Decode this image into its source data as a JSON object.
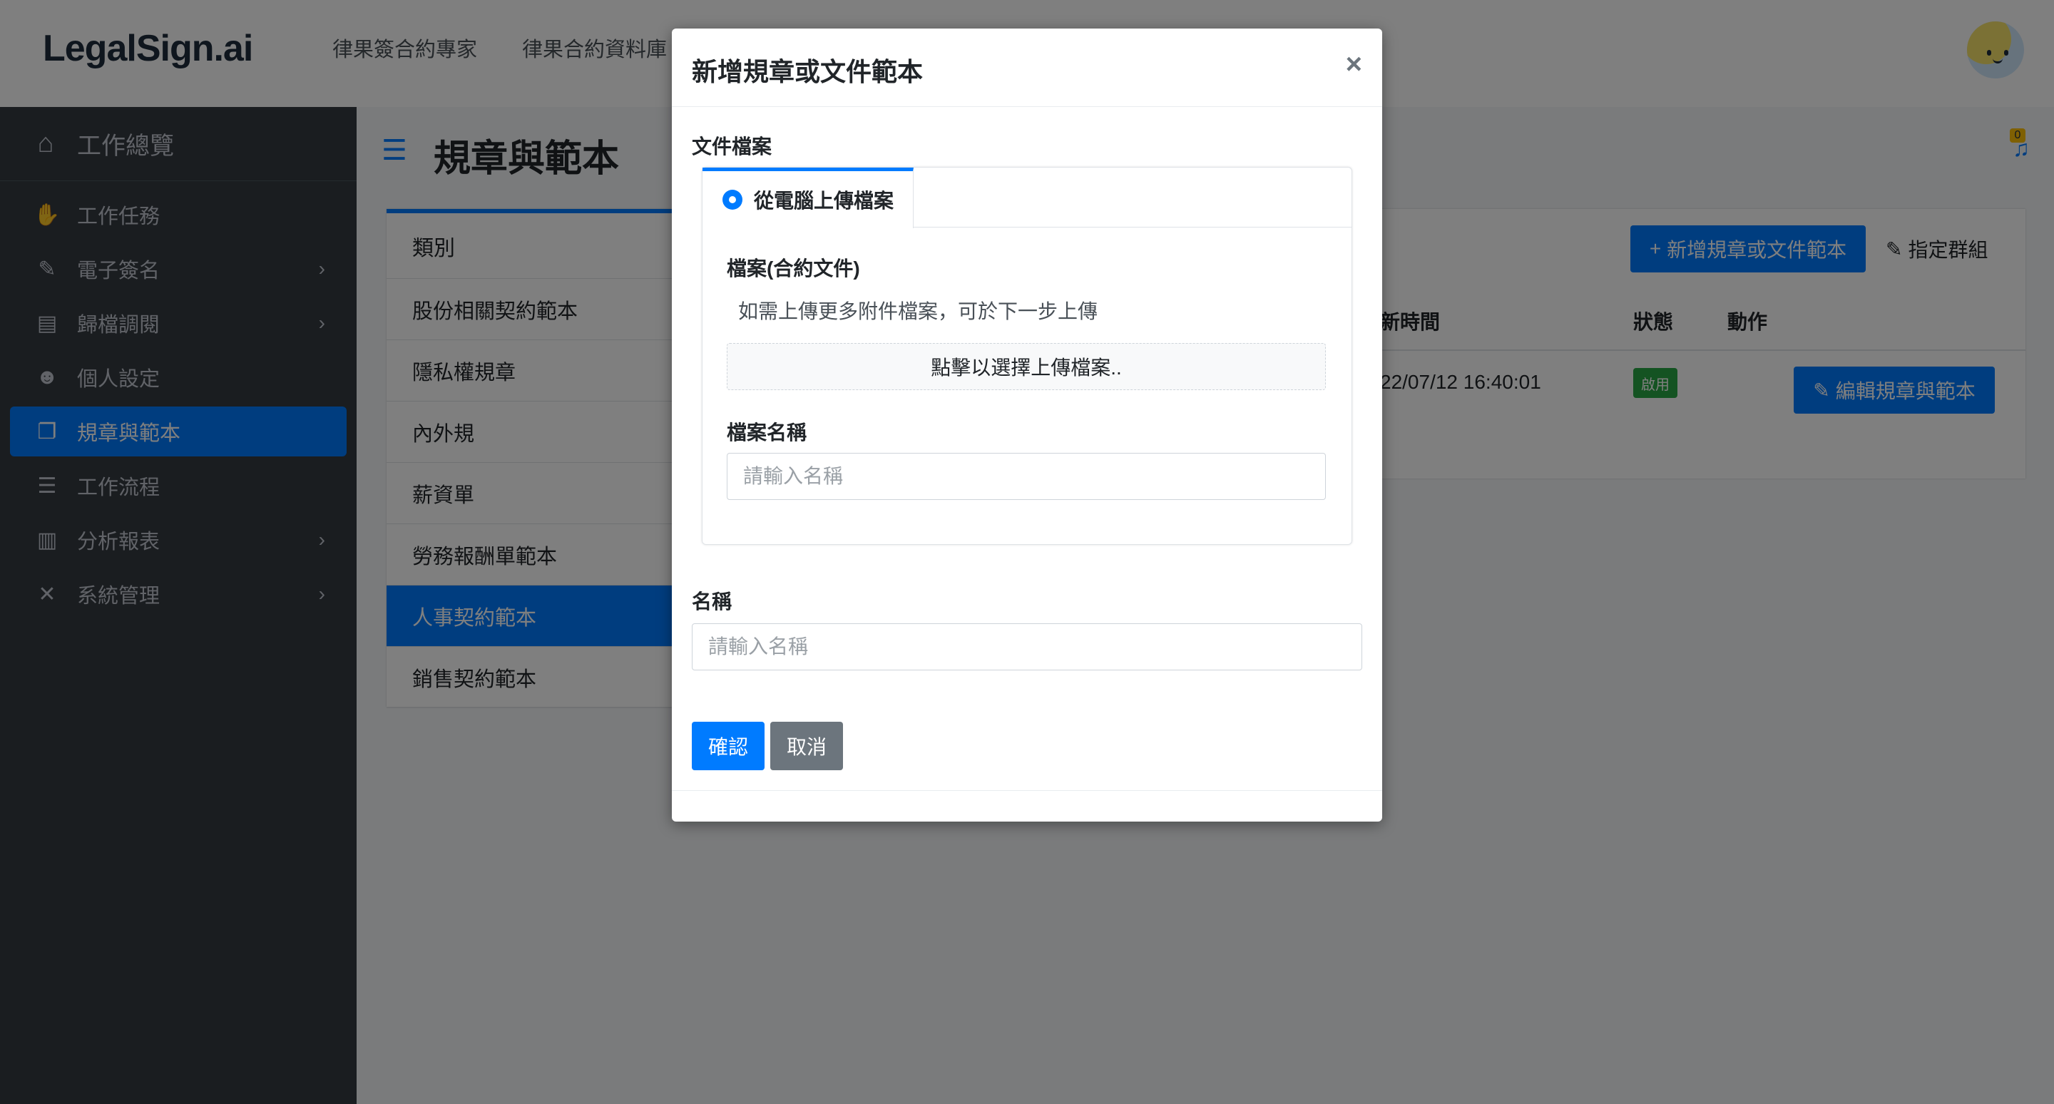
{
  "topbar": {
    "logo": "LegalSign.ai",
    "nav": [
      "律果簽合約專家",
      "律果合約資料庫"
    ]
  },
  "sidebar": {
    "brand": {
      "label": "工作總覽",
      "icon": "home-icon"
    },
    "items": [
      {
        "label": "工作任務",
        "icon": "handshake-icon",
        "chevron": false
      },
      {
        "label": "電子簽名",
        "icon": "signature-icon",
        "chevron": true
      },
      {
        "label": "歸檔調閱",
        "icon": "archive-icon",
        "chevron": true
      },
      {
        "label": "個人設定",
        "icon": "user-cog-icon",
        "chevron": false
      },
      {
        "label": "規章與範本",
        "icon": "copy-icon",
        "chevron": false,
        "active": true
      },
      {
        "label": "工作流程",
        "icon": "tasks-icon",
        "chevron": false
      },
      {
        "label": "分析報表",
        "icon": "chart-bar-icon",
        "chevron": true
      },
      {
        "label": "系統管理",
        "icon": "tools-icon",
        "chevron": true
      }
    ]
  },
  "content": {
    "title": "規章與範本",
    "notification_count": "0",
    "categories": {
      "header": "類別",
      "items": [
        "股份相關契約範本",
        "隱私權規章",
        "內外規",
        "薪資單",
        "勞務報酬單範本",
        "人事契約範本",
        "銷售契約範本"
      ],
      "active_index": 5
    },
    "add_button": "新增規章或文件範本",
    "group_button": "指定群組",
    "table": {
      "headers": [
        "新時間",
        "狀態",
        "動作"
      ],
      "rows": [
        {
          "time": "22/07/12 16:40:01",
          "status": "啟用",
          "action": "編輯規章與範本"
        }
      ]
    }
  },
  "modal": {
    "title": "新增規章或文件範本",
    "close": "×",
    "section_label": "文件檔案",
    "tab_label": "從電腦上傳檔案",
    "file_label": "檔案(合約文件)",
    "hint": "如需上傳更多附件檔案，可於下一步上傳",
    "dropzone": "點擊以選擇上傳檔案..",
    "filename_label": "檔案名稱",
    "filename_placeholder": "請輸入名稱",
    "name_label": "名稱",
    "name_placeholder": "請輸入名稱",
    "confirm": "確認",
    "cancel": "取消"
  }
}
